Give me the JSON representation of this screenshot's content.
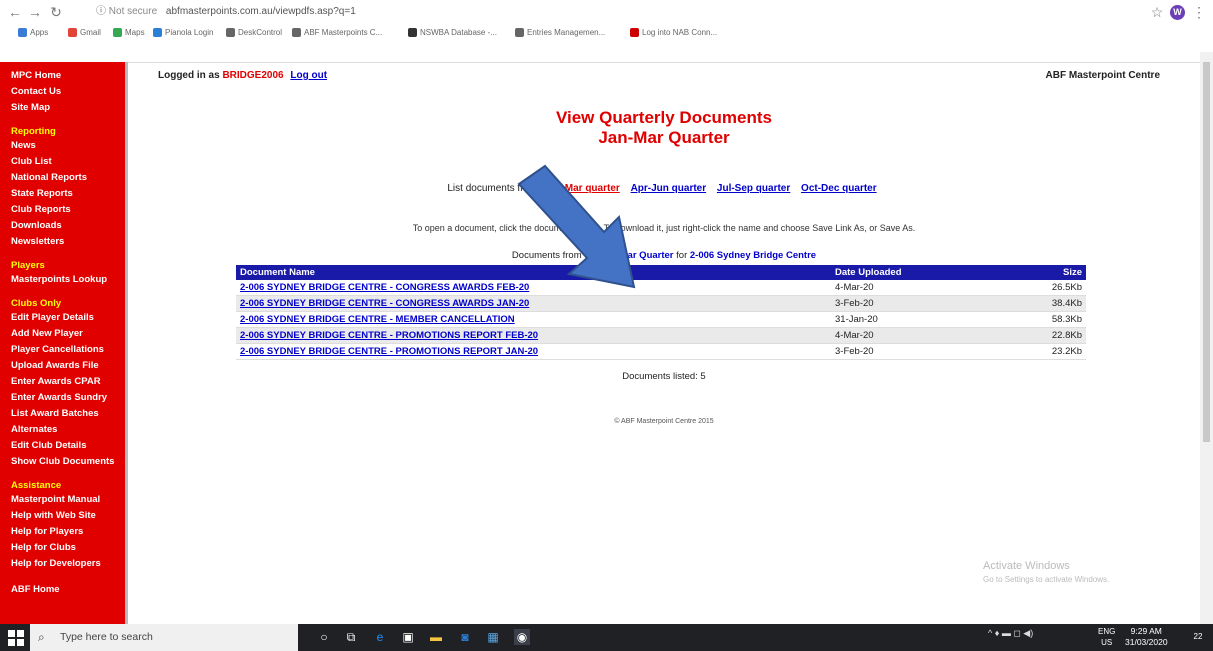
{
  "browser": {
    "security": "Not secure",
    "url": "abfmasterpoints.com.au/viewpdfs.asp?q=1",
    "profile_initial": "W",
    "bookmarks": [
      {
        "label": "Apps",
        "color": "#3a7bd5"
      },
      {
        "label": "Gmail",
        "color": "#e24436"
      },
      {
        "label": "Maps",
        "color": "#34a853"
      },
      {
        "label": "Pianola Login",
        "color": "#2b7fd4"
      },
      {
        "label": "DeskControl",
        "color": "#666666"
      },
      {
        "label": "ABF Masterpoints C...",
        "color": "#666666"
      },
      {
        "label": "NSWBA Database -...",
        "color": "#333333"
      },
      {
        "label": "Entries Managemen...",
        "color": "#666666"
      },
      {
        "label": "Log into NAB Conn...",
        "color": "#cc0000"
      }
    ]
  },
  "sidebar": {
    "sections": [
      {
        "title": "",
        "items": [
          "MPC Home",
          "Contact Us",
          "Site Map"
        ]
      },
      {
        "title": "Reporting",
        "items": [
          "News",
          "Club List",
          "National Reports",
          "State Reports",
          "Club Reports",
          "Downloads",
          "Newsletters"
        ]
      },
      {
        "title": "Players",
        "items": [
          "Masterpoints Lookup"
        ]
      },
      {
        "title": "Clubs Only",
        "items": [
          "Edit Player Details",
          "Add New Player",
          "Player Cancellations",
          "Upload Awards File",
          "Enter Awards CPAR",
          "Enter Awards Sundry",
          "List Award Batches",
          "Alternates",
          "Edit Club Details",
          "Show Club Documents"
        ]
      },
      {
        "title": "Assistance",
        "items": [
          "Masterpoint Manual",
          "Help with Web Site",
          "Help for Players",
          "Help for Clubs",
          "Help for Developers"
        ]
      },
      {
        "title": "",
        "items": [
          "ABF Home"
        ]
      }
    ]
  },
  "header": {
    "logged_in_prefix": "Logged in as",
    "username": "BRIDGE2006",
    "logout_label": "Log out",
    "site_title": "ABF Masterpoint Centre"
  },
  "main": {
    "title_line1": "View Quarterly Documents",
    "title_line2": "Jan-Mar Quarter",
    "list_prefix": "List documents from",
    "quarters": [
      "Jan-Mar quarter",
      "Apr-Jun quarter",
      "Jul-Sep quarter",
      "Oct-Dec quarter"
    ],
    "instructions": "To open a document, click the document name. To download it, just right-click the name and choose Save Link As, or Save As.",
    "docs_from_prefix": "Documents from the",
    "docs_from_quarter": "Jan-Mar Quarter",
    "docs_from_for": "for",
    "docs_from_club": "2-006 Sydney Bridge Centre",
    "columns": [
      "Document Name",
      "Date Uploaded",
      "Size"
    ],
    "rows": [
      {
        "name": "2-006 SYDNEY BRIDGE CENTRE - CONGRESS AWARDS FEB-20",
        "date": "4-Mar-20",
        "size": "26.5Kb"
      },
      {
        "name": "2-006 SYDNEY BRIDGE CENTRE - CONGRESS AWARDS JAN-20",
        "date": "3-Feb-20",
        "size": "38.4Kb"
      },
      {
        "name": "2-006 SYDNEY BRIDGE CENTRE - MEMBER CANCELLATION",
        "date": "31-Jan-20",
        "size": "58.3Kb"
      },
      {
        "name": "2-006 SYDNEY BRIDGE CENTRE - PROMOTIONS REPORT FEB-20",
        "date": "4-Mar-20",
        "size": "22.8Kb"
      },
      {
        "name": "2-006 SYDNEY BRIDGE CENTRE - PROMOTIONS REPORT JAN-20",
        "date": "3-Feb-20",
        "size": "23.2Kb"
      }
    ],
    "listed_label": "Documents listed: 5",
    "copyright": "© ABF Masterpoint Centre 2015"
  },
  "watermark": {
    "line1": "Activate Windows",
    "line2": "Go to Settings to activate Windows."
  },
  "taskbar": {
    "search_placeholder": "Type here to search",
    "lang": "ENG",
    "region": "US",
    "time": "9:29 AM",
    "date": "31/03/2020",
    "notifications": "22"
  }
}
